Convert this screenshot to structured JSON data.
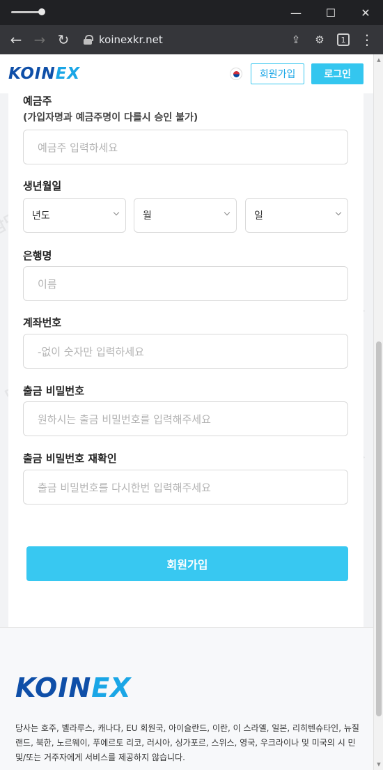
{
  "browser": {
    "url": "koinexkr.net",
    "tab_count": "1",
    "win_min": "—",
    "win_max": "☐",
    "win_close": "✕",
    "back": "←",
    "forward": "→",
    "reload": "↻",
    "share": "⇪",
    "extensions": "⚙",
    "menu": "⋮"
  },
  "header": {
    "logo_main": "KOIN",
    "logo_accent": "EX",
    "signup_label": "회원가입",
    "login_label": "로그인"
  },
  "form": {
    "depositor": {
      "label": "예금주",
      "note": "(가입자명과 예금주명이 다를시 승인 불가)",
      "placeholder": "예금주 입력하세요"
    },
    "birth": {
      "label": "생년월일",
      "year": "년도",
      "month": "월",
      "day": "일"
    },
    "bank": {
      "label": "은행명",
      "placeholder": "이름"
    },
    "account": {
      "label": "계좌번호",
      "placeholder": "-없이 숫자만 입력하세요"
    },
    "withdraw_pw": {
      "label": "출금 비밀번호",
      "placeholder": "원하시는 출금 비밀번호를 입력해주세요"
    },
    "withdraw_pw_confirm": {
      "label": "출금 비밀번호 재확인",
      "placeholder": "출금 비밀번호를 다시한번 입력해주세요"
    },
    "submit_label": "회원가입"
  },
  "footer": {
    "logo_main": "KOIN",
    "logo_accent": "EX",
    "notice": "당사는 호주, 벨라루스, 캐나다, EU 회원국, 아이슬란드, 이란, 이 스라엘, 일본, 리히텐슈타인, 뉴질랜드, 북한, 노르웨이, 푸에르토 리코, 러시아, 싱가포르, 스위스, 영국, 우크라이나 및 미국의 시 민 및/또는 거주자에게 서비스를 제공하지 않습니다."
  },
  "watermark_text": "담덕 법률사무소",
  "colors": {
    "accent": "#38c8f1",
    "brand_dark": "#0f4fa8",
    "brand_light": "#1aa6e6"
  }
}
